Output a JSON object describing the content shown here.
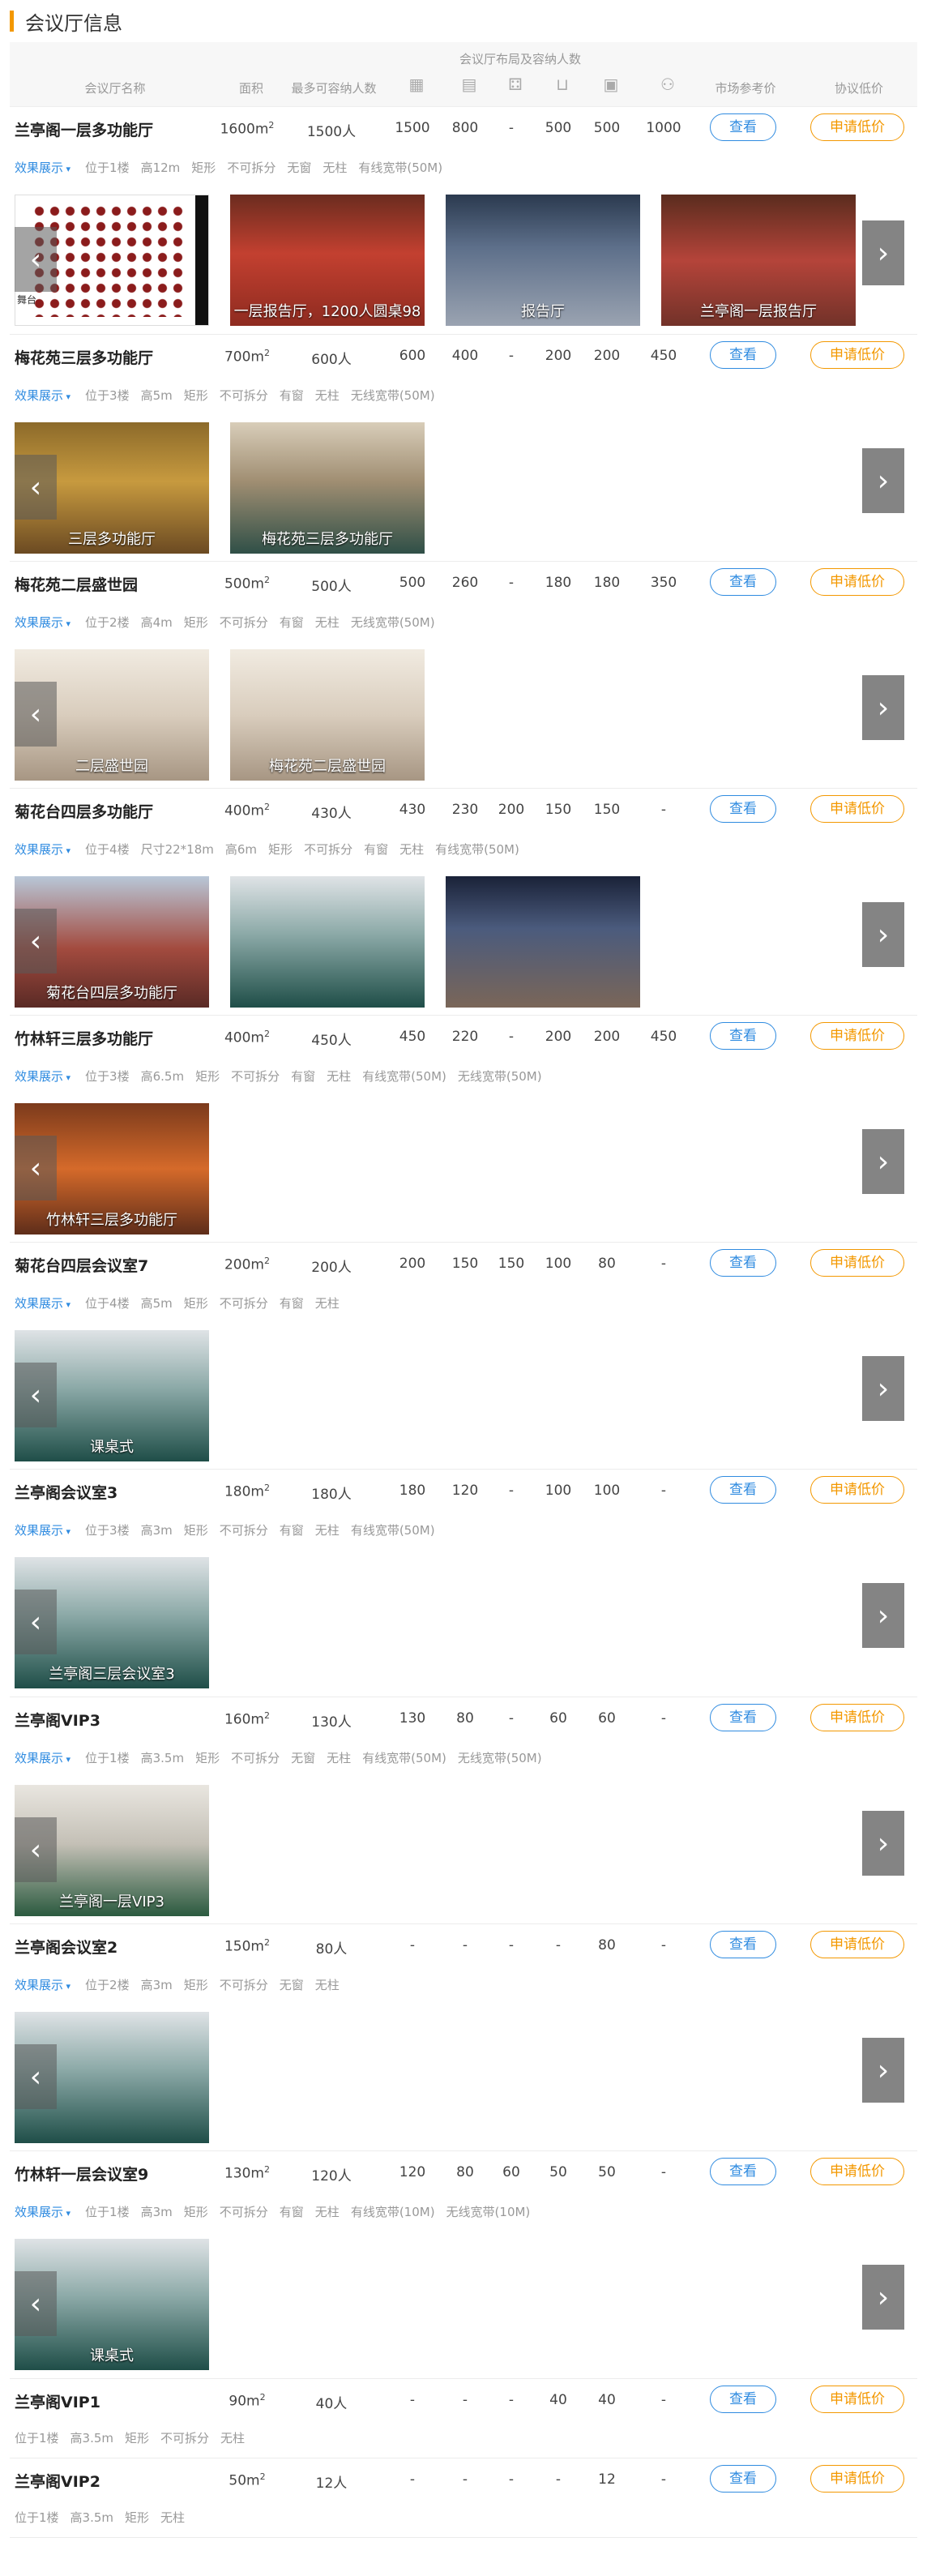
{
  "section_title": "会议厅信息",
  "header": {
    "group_label": "会议厅布局及容纳人数",
    "name": "会议厅名称",
    "area": "面积",
    "capacity": "最多可容纳人数",
    "market_price": "市场参考价",
    "protocol_price": "协议低价",
    "layout_icons": [
      "theater-icon",
      "classroom-icon",
      "banquet-icon",
      "u-shape-icon",
      "boardroom-icon",
      "cocktail-icon"
    ]
  },
  "view_label": "查看",
  "price_label": "申请低价",
  "effect_label": "效果展示",
  "rooms": [
    {
      "name": "兰亭阁一层多功能厅",
      "area": "1600m",
      "capacity": "1500人",
      "layouts": [
        "1500",
        "800",
        "-",
        "500",
        "500",
        "1000"
      ],
      "tags": [
        "位于1楼",
        "高12m",
        "矩形",
        "不可拆分",
        "无窗",
        "无柱",
        "有线宽带(50M)"
      ],
      "photos": [
        {
          "caption": "",
          "style": "plan"
        },
        {
          "caption": "一层报告厅，1200人圆桌98",
          "style": "a"
        },
        {
          "caption": "报告厅",
          "style": "b"
        },
        {
          "caption": "兰亭阁一层报告厅",
          "style": "c"
        }
      ],
      "plan_label": "舞台"
    },
    {
      "name": "梅花苑三层多功能厅",
      "area": "700m",
      "capacity": "600人",
      "layouts": [
        "600",
        "400",
        "-",
        "200",
        "200",
        "450"
      ],
      "tags": [
        "位于3楼",
        "高5m",
        "矩形",
        "不可拆分",
        "有窗",
        "无柱",
        "无线宽带(50M)"
      ],
      "photos": [
        {
          "caption": "三层多功能厅",
          "style": "gold"
        },
        {
          "caption": "梅花苑三层多功能厅",
          "style": "hall"
        }
      ]
    },
    {
      "name": "梅花苑二层盛世园",
      "area": "500m",
      "capacity": "500人",
      "layouts": [
        "500",
        "260",
        "-",
        "180",
        "180",
        "350"
      ],
      "tags": [
        "位于2楼",
        "高4m",
        "矩形",
        "不可拆分",
        "有窗",
        "无柱",
        "无线宽带(50M)"
      ],
      "photos": [
        {
          "caption": "二层盛世园",
          "style": "white"
        },
        {
          "caption": "梅花苑二层盛世园",
          "style": "white"
        }
      ]
    },
    {
      "name": "菊花台四层多功能厅",
      "area": "400m",
      "capacity": "430人",
      "layouts": [
        "430",
        "230",
        "200",
        "150",
        "150",
        "-"
      ],
      "tags": [
        "位于4楼",
        "尺寸22*18m",
        "高6m",
        "矩形",
        "不可拆分",
        "有窗",
        "无柱",
        "有线宽带(50M)"
      ],
      "photos": [
        {
          "caption": "菊花台四层多功能厅",
          "style": "red"
        },
        {
          "caption": "",
          "style": "green"
        },
        {
          "caption": "",
          "style": "blue"
        }
      ]
    },
    {
      "name": "竹林轩三层多功能厅",
      "area": "400m",
      "capacity": "450人",
      "layouts": [
        "450",
        "220",
        "-",
        "200",
        "200",
        "450"
      ],
      "tags": [
        "位于3楼",
        "高6.5m",
        "矩形",
        "不可拆分",
        "有窗",
        "无柱",
        "有线宽带(50M)",
        "无线宽带(50M)"
      ],
      "photos": [
        {
          "caption": "竹林轩三层多功能厅",
          "style": "orange"
        }
      ]
    },
    {
      "name": "菊花台四层会议室7",
      "area": "200m",
      "capacity": "200人",
      "layouts": [
        "200",
        "150",
        "150",
        "100",
        "80",
        "-"
      ],
      "tags": [
        "位于4楼",
        "高5m",
        "矩形",
        "不可拆分",
        "有窗",
        "无柱"
      ],
      "photos": [
        {
          "caption": "课桌式",
          "style": "green"
        }
      ]
    },
    {
      "name": "兰亭阁会议室3",
      "area": "180m",
      "capacity": "180人",
      "layouts": [
        "180",
        "120",
        "-",
        "100",
        "100",
        "-"
      ],
      "tags": [
        "位于3楼",
        "高3m",
        "矩形",
        "不可拆分",
        "有窗",
        "无柱",
        "有线宽带(50M)"
      ],
      "photos": [
        {
          "caption": "兰亭阁三层会议室3",
          "style": "green"
        }
      ]
    },
    {
      "name": "兰亭阁VIP3",
      "area": "160m",
      "capacity": "130人",
      "layouts": [
        "130",
        "80",
        "-",
        "60",
        "60",
        "-"
      ],
      "tags": [
        "位于1楼",
        "高3.5m",
        "矩形",
        "不可拆分",
        "无窗",
        "无柱",
        "有线宽带(50M)",
        "无线宽带(50M)"
      ],
      "photos": [
        {
          "caption": "兰亭阁一层VIP3",
          "style": "vip"
        }
      ]
    },
    {
      "name": "兰亭阁会议室2",
      "area": "150m",
      "capacity": "80人",
      "layouts": [
        "-",
        "-",
        "-",
        "-",
        "80",
        "-"
      ],
      "tags": [
        "位于2楼",
        "高3m",
        "矩形",
        "不可拆分",
        "无窗",
        "无柱"
      ],
      "photos": [
        {
          "caption": "",
          "style": "green"
        }
      ]
    },
    {
      "name": "竹林轩一层会议室9",
      "area": "130m",
      "capacity": "120人",
      "layouts": [
        "120",
        "80",
        "60",
        "50",
        "50",
        "-"
      ],
      "tags": [
        "位于1楼",
        "高3m",
        "矩形",
        "不可拆分",
        "有窗",
        "无柱",
        "有线宽带(10M)",
        "无线宽带(10M)"
      ],
      "photos": [
        {
          "caption": "课桌式",
          "style": "green"
        }
      ]
    },
    {
      "name": "兰亭阁VIP1",
      "area": "90m",
      "capacity": "40人",
      "layouts": [
        "-",
        "-",
        "-",
        "40",
        "40",
        "-"
      ],
      "tags": [
        "位于1楼",
        "高3.5m",
        "矩形",
        "不可拆分",
        "无柱"
      ],
      "photos": []
    },
    {
      "name": "兰亭阁VIP2",
      "area": "50m",
      "capacity": "12人",
      "layouts": [
        "-",
        "-",
        "-",
        "-",
        "12",
        "-"
      ],
      "tags": [
        "位于1楼",
        "高3.5m",
        "矩形",
        "无柱"
      ],
      "photos": []
    }
  ]
}
